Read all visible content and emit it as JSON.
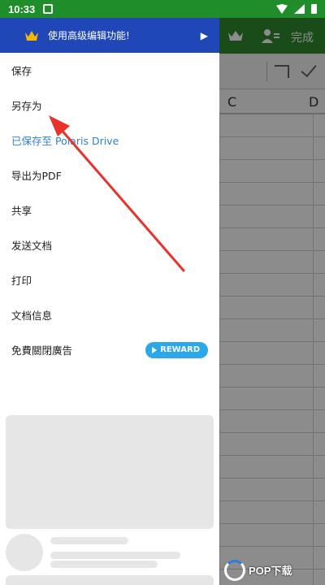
{
  "status_bar": {
    "time": "10:33"
  },
  "background_app": {
    "toolbar": {
      "done_label": "完成"
    },
    "columns": [
      "C",
      "D"
    ]
  },
  "drawer": {
    "premium_banner": {
      "label": "使用高级编辑功能!"
    },
    "menu_items": [
      {
        "label": "保存"
      },
      {
        "label": "另存为"
      },
      {
        "label": "已保存至 Polaris Drive"
      },
      {
        "label": "导出为PDF"
      },
      {
        "label": "共享"
      },
      {
        "label": "发送文档"
      },
      {
        "label": "打印"
      },
      {
        "label": "文档信息"
      },
      {
        "label": "免費關閉廣告"
      }
    ],
    "reward_label": "REWARD"
  },
  "watermark": {
    "text": "POP下载"
  },
  "colors": {
    "status_green": "#1f8e2a",
    "toolbar_green": "#2e8b2e",
    "premium_blue": "#1f47b8",
    "link_blue": "#2f7fd8",
    "reward_blue": "#2aa8ea",
    "arrow_red": "#e8322a"
  }
}
